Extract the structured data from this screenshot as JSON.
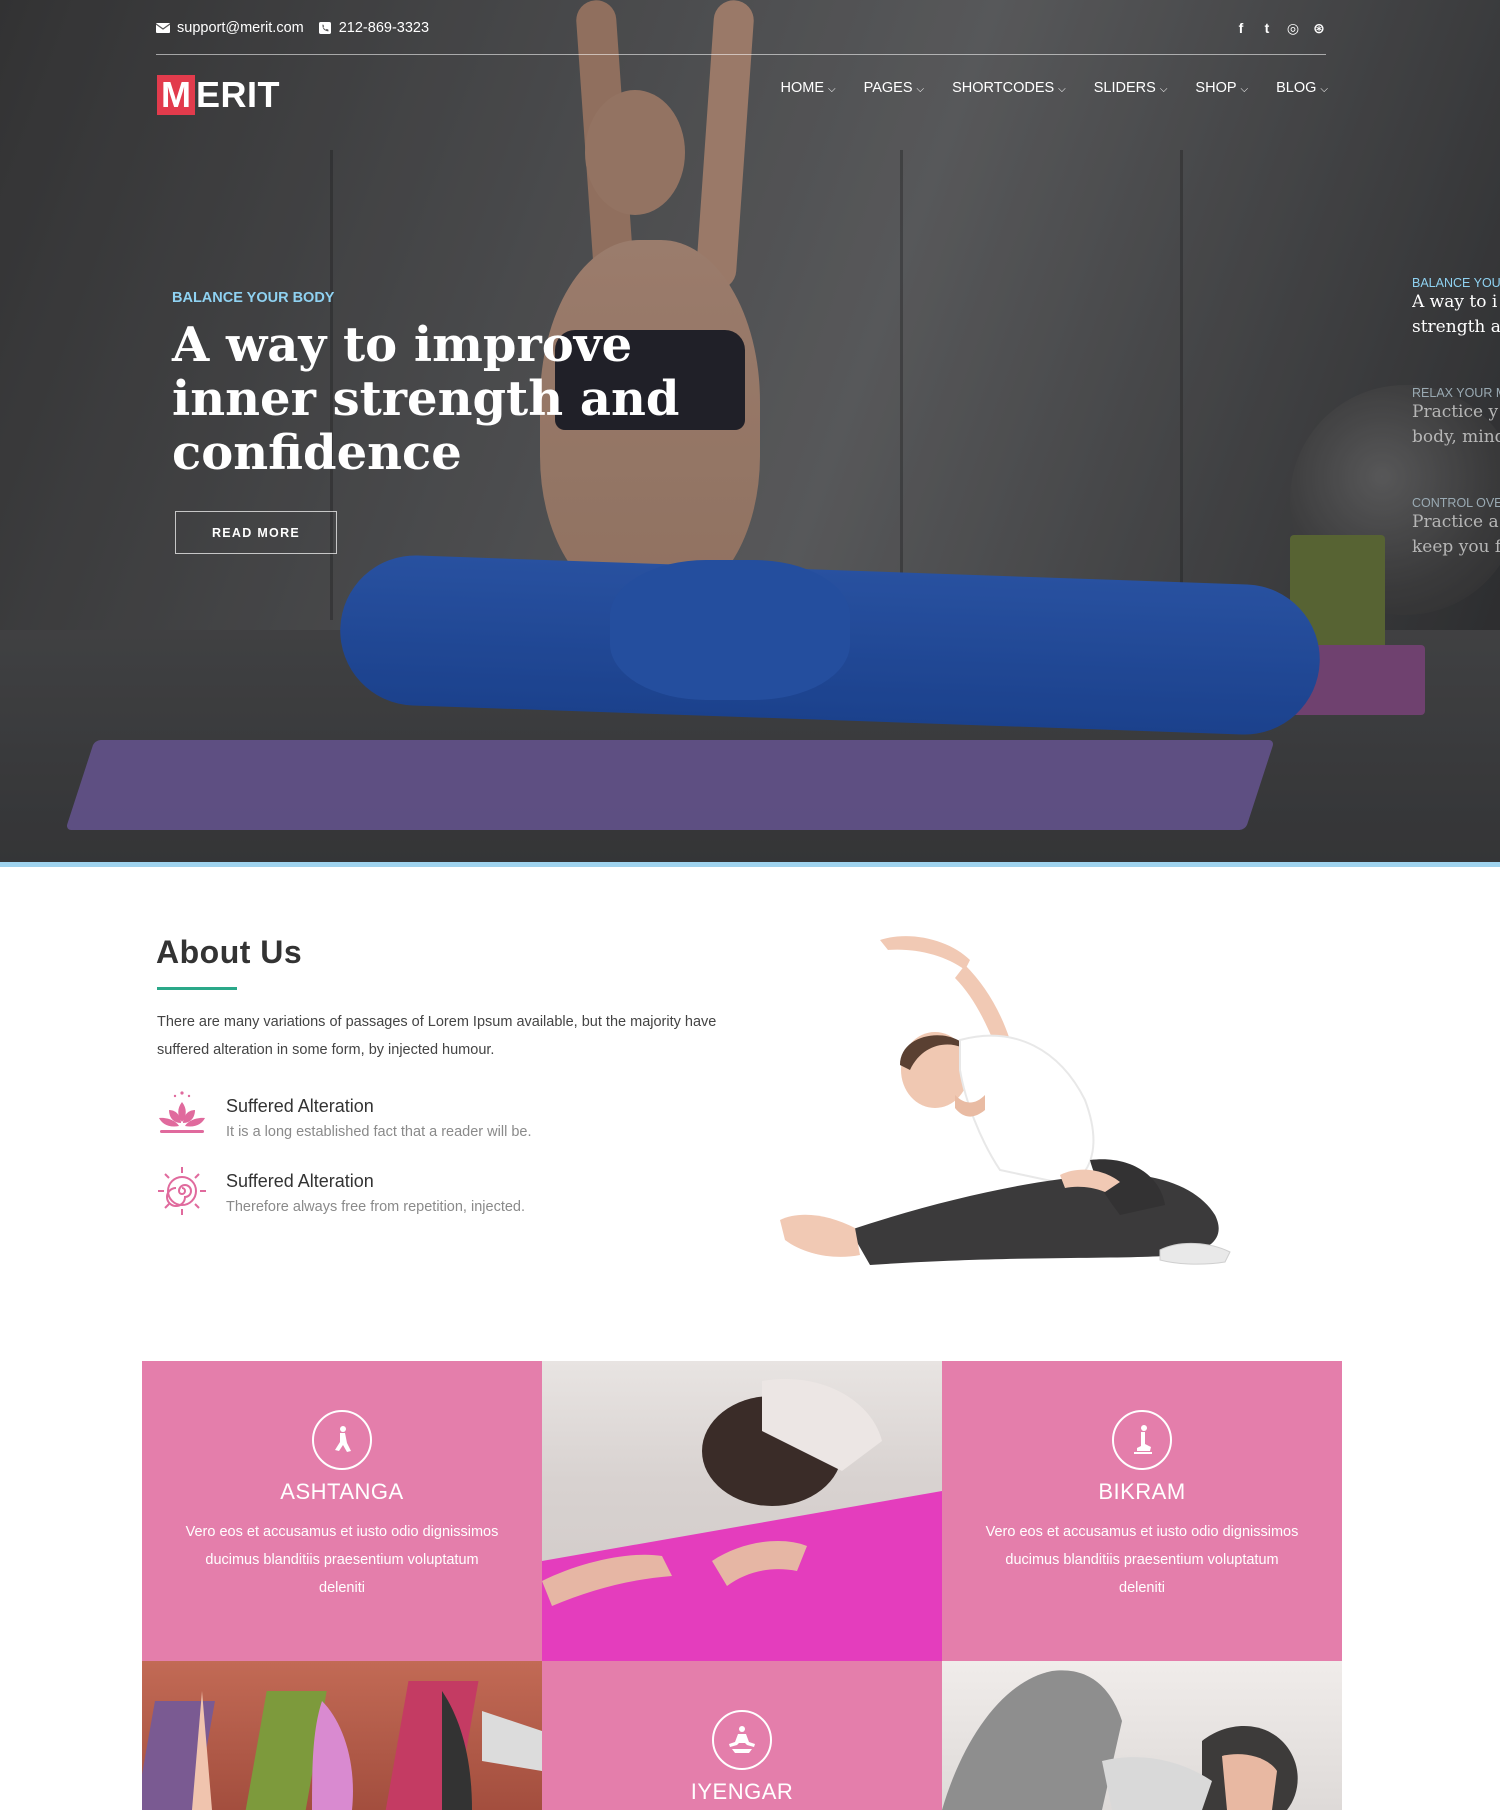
{
  "topbar": {
    "email": "support@merit.com",
    "phone": "212-869-3323",
    "social": [
      {
        "name": "facebook-icon",
        "glyph": "f"
      },
      {
        "name": "twitter-icon",
        "glyph": "t"
      },
      {
        "name": "instagram-icon",
        "glyph": "◎"
      },
      {
        "name": "dribbble-icon",
        "glyph": "⊛"
      }
    ]
  },
  "logo": {
    "first_letter": "M",
    "rest": "ERIT"
  },
  "nav": {
    "items": [
      {
        "label": "HOME"
      },
      {
        "label": "PAGES"
      },
      {
        "label": "SHORTCODES"
      },
      {
        "label": "SLIDERS"
      },
      {
        "label": "SHOP"
      },
      {
        "label": "BLOG"
      }
    ]
  },
  "hero": {
    "kicker": "BALANCE YOUR BODY",
    "title": "A way to improve inner strength and confidence",
    "button": "READ MORE"
  },
  "side_tabs": [
    {
      "kicker": "BALANCE YOU",
      "line1": "A way to i",
      "line2": "strength a"
    },
    {
      "kicker": "RELAX YOUR M",
      "line1": "Practice y",
      "line2": "body, mind"
    },
    {
      "kicker": "CONTROL OVE",
      "line1": "Practice a",
      "line2": "keep you f"
    }
  ],
  "about": {
    "title": "About Us",
    "text": "There are many variations of passages of Lorem Ipsum available, but the majority have suffered alteration in some form, by injected humour.",
    "features": [
      {
        "title": "Suffered Alteration",
        "text": "It is a long established fact that a reader will be."
      },
      {
        "title": "Suffered Alteration",
        "text": "Therefore always free from repetition, injected."
      }
    ]
  },
  "classes": [
    {
      "title": "ASHTANGA",
      "desc": "Vero eos et accusamus et iusto odio dignissimos ducimus blanditiis praesentium voluptatum deleniti"
    },
    {
      "title": "BIKRAM",
      "desc": "Vero eos et accusamus et iusto odio dignissimos ducimus blanditiis praesentium voluptatum deleniti"
    },
    {
      "title": "IYENGAR",
      "desc": ""
    }
  ],
  "colors": {
    "accent_red": "#e23b4c",
    "kicker_blue": "#8fd2f2",
    "pink": "#e47eab",
    "teal_rule": "#2aa889",
    "lotus_pink": "#e06a9d"
  }
}
